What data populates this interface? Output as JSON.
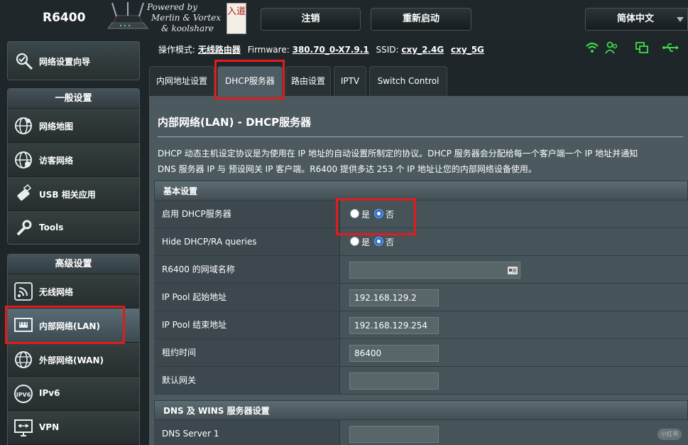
{
  "header": {
    "model": "R6400",
    "powered_by": [
      "Powered by",
      "Merlin & Vortex",
      "& koolshare"
    ],
    "logo_text": "入道",
    "logout": "注销",
    "reboot": "重新启动",
    "language": "简体中文"
  },
  "status": {
    "mode_label": "操作模式:",
    "mode_value": "无线路由器",
    "firmware_label": "Firmware:",
    "firmware_value": "380.70_0-X7.9.1",
    "ssid_label": "SSID:",
    "ssid_1": "cxy_2.4G",
    "ssid_2": "cxy_5G",
    "icons": [
      "wifi-icon",
      "users-icon",
      "devices-icon",
      "usb-icon"
    ]
  },
  "sidebar": {
    "wizard": "网络设置向导",
    "general_title": "一般设置",
    "general_items": [
      {
        "label": "网络地图",
        "icon": "globe-map-icon"
      },
      {
        "label": "访客网络",
        "icon": "guest-network-icon"
      },
      {
        "label": "USB 相关应用",
        "icon": "usb-stick-icon"
      },
      {
        "label": "Tools",
        "icon": "wrench-icon"
      }
    ],
    "advanced_title": "高级设置",
    "advanced_items": [
      {
        "label": "无线网络",
        "icon": "wireless-icon"
      },
      {
        "label": "内部网络(LAN)",
        "icon": "lan-icon",
        "active": true
      },
      {
        "label": "外部网络(WAN)",
        "icon": "wan-globe-icon"
      },
      {
        "label": "IPv6",
        "icon": "ipv6-icon"
      },
      {
        "label": "VPN",
        "icon": "vpn-icon"
      }
    ]
  },
  "tabs": [
    "内网地址设置",
    "DHCP服务器",
    "路由设置",
    "IPTV",
    "Switch Control"
  ],
  "active_tab": 1,
  "content": {
    "title": "内部网络(LAN) - DHCP服务器",
    "desc_line1": "DHCP 动态主机设定协议是为使用在 IP 地址的自动设置所制定的协议。DHCP 服务器会分配给每一个客户端一个 IP 地址并通知",
    "desc_line2": "DNS 服务器 IP 与 预设网关 IP 客户端。R6400 提供多达 253 个 IP 地址让您的内部网络设备使用。",
    "basic_section": "基本设置",
    "rows": {
      "enable_dhcp": {
        "label": "启用 DHCP服务器",
        "yes": "是",
        "no": "否",
        "selected": "否"
      },
      "hide_dhcp": {
        "label": "Hide DHCP/RA queries",
        "yes": "是",
        "no": "否",
        "selected": "否"
      },
      "domain_name": {
        "label": "R6400 的网域名称",
        "value": ""
      },
      "pool_start": {
        "label": "IP Pool 起始地址",
        "value": "192.168.129.2"
      },
      "pool_end": {
        "label": "IP Pool 结束地址",
        "value": "192.168.129.254"
      },
      "lease_time": {
        "label": "租约时间",
        "value": "86400"
      },
      "gateway": {
        "label": "默认网关",
        "value": ""
      }
    },
    "dns_section": "DNS 及 WINS 服务器设置",
    "dns_server1": {
      "label": "DNS Server 1",
      "value": ""
    }
  },
  "watermark": "小红书",
  "colors": {
    "background": "#1f2629",
    "content": "#4c5a60",
    "highlight": "#e21b1b",
    "radio_selected": "#2f6fd6",
    "status_green": "#3ddc4a"
  }
}
